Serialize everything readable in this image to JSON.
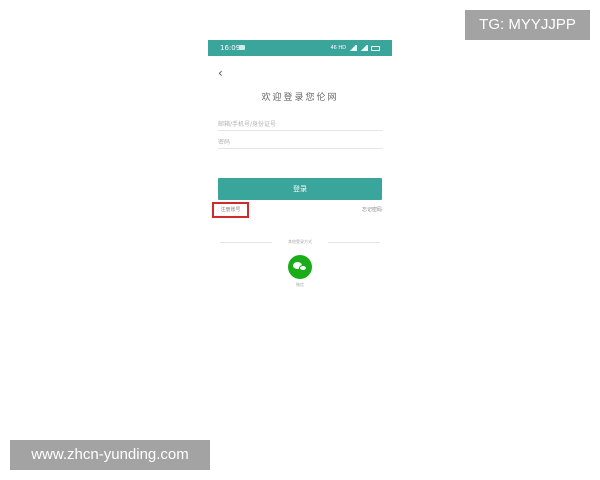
{
  "watermarks": {
    "top": "TG: MYYJJPP",
    "bottom": "www.zhcn-yunding.com"
  },
  "status_bar": {
    "time": "16:09",
    "network": "46 HD",
    "color": "#3aa59b"
  },
  "login": {
    "title": "欢迎登录您伦网",
    "account_placeholder": "邮箱/手机号/身份证号",
    "password_placeholder": "密码",
    "login_button": "登录",
    "register_link": "注册账号",
    "forgot_link": "忘记密码",
    "other_methods": "其他登录方式",
    "wechat_label": "微信",
    "accent_color": "#3aa59b",
    "highlight_color": "#d12a2a"
  }
}
